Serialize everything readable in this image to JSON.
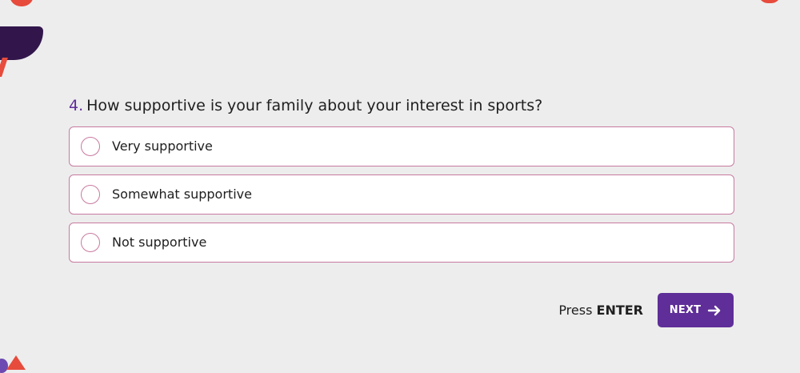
{
  "question": {
    "number": "4.",
    "text": "How supportive is your family about your interest in sports?"
  },
  "options": [
    {
      "label": "Very supportive"
    },
    {
      "label": "Somewhat supportive"
    },
    {
      "label": "Not supportive"
    }
  ],
  "footer": {
    "press_label": "Press",
    "enter_label": "ENTER",
    "next_label": "NEXT"
  },
  "colors": {
    "background": "#ededed",
    "accent": "#5f2e98",
    "option_border": "#c77aa0",
    "decor_red": "#e74b3c",
    "decor_dark_purple": "#32164b"
  },
  "icons": {
    "next": "arrow-right-icon"
  }
}
